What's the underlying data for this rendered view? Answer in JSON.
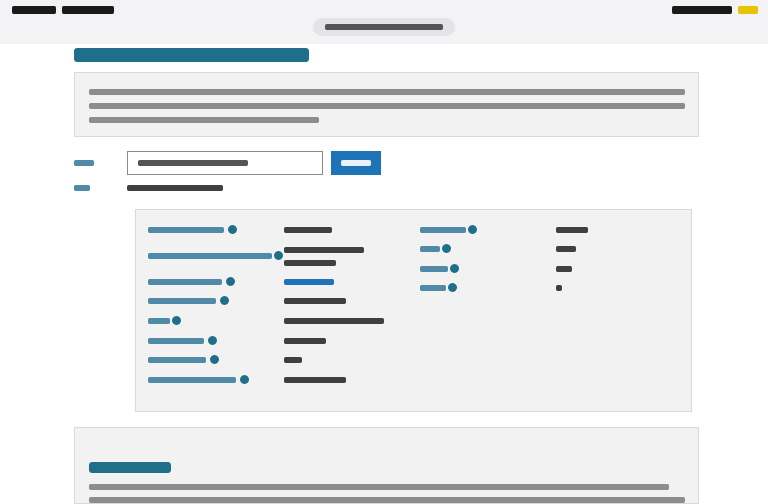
{
  "status_bar": {},
  "address_bar": {},
  "page": {},
  "search": {},
  "result": {},
  "disclaimer": {}
}
